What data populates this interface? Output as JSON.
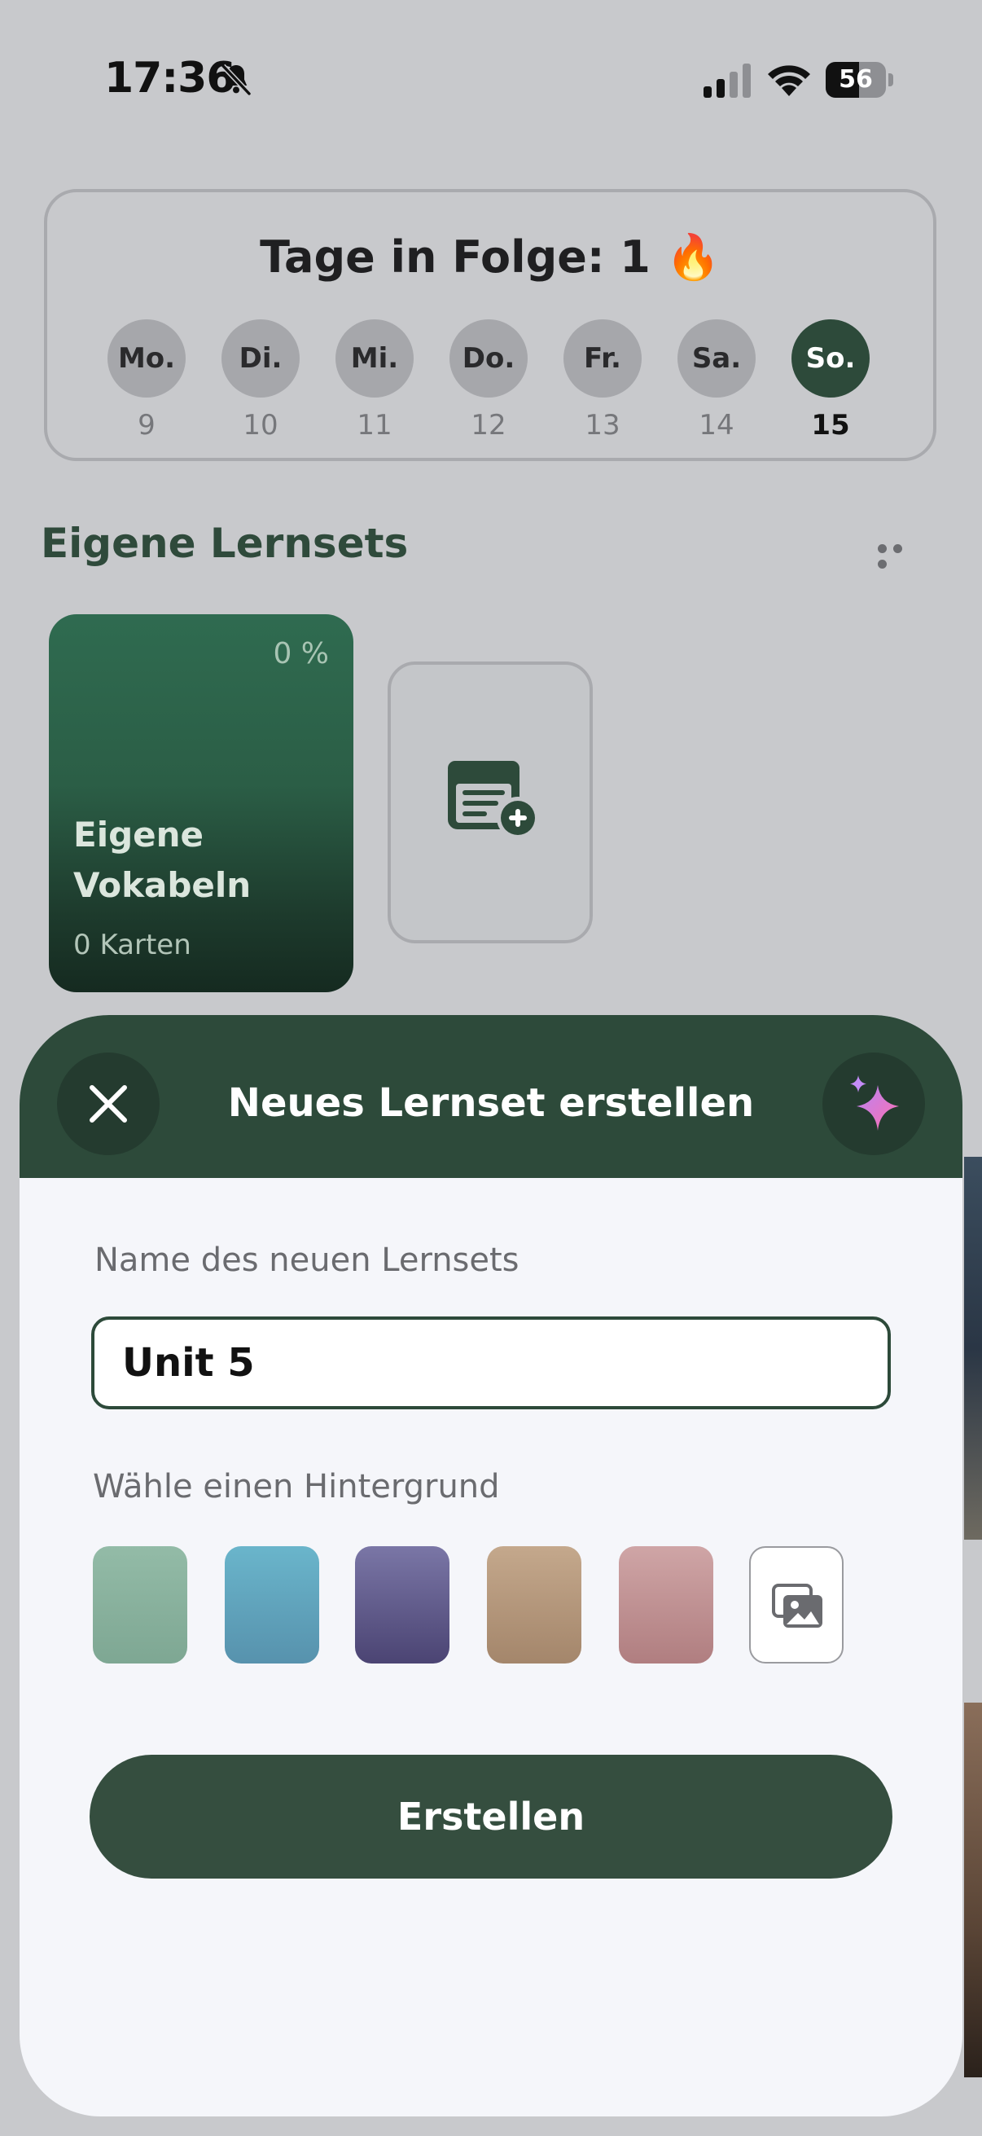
{
  "status_bar": {
    "time": "17:36",
    "battery": "56",
    "battery_level": 0.56,
    "icons": [
      "bell-slash-icon",
      "signal-icon",
      "wifi-icon",
      "battery-icon"
    ]
  },
  "streak": {
    "title": "Tage in Folge: 1 🔥",
    "days": [
      {
        "label": "Mo.",
        "num": "9"
      },
      {
        "label": "Di.",
        "num": "10"
      },
      {
        "label": "Mi.",
        "num": "11"
      },
      {
        "label": "Do.",
        "num": "12"
      },
      {
        "label": "Fr.",
        "num": "13"
      },
      {
        "label": "Sa.",
        "num": "14"
      },
      {
        "label": "So.",
        "num": "15",
        "active": true
      }
    ]
  },
  "section": {
    "title": "Eigene Lernsets"
  },
  "set_card": {
    "percent": "0 %",
    "name": "Eigene Vokabeln",
    "count": "0 Karten"
  },
  "sheet": {
    "title": "Neues Lernset erstellen",
    "name_label": "Name des neuen Lernsets",
    "name_value": "Unit 5",
    "bg_label": "Wähle einen Hintergrund",
    "swatches": [
      {
        "from": "#93bba7",
        "to": "#7ea793"
      },
      {
        "from": "#6ab5cb",
        "to": "#5792ad"
      },
      {
        "from": "#7a76a6",
        "to": "#4b4473"
      },
      {
        "from": "#c4a88c",
        "to": "#a4866b"
      },
      {
        "from": "#cfa5a6",
        "to": "#b07e80"
      }
    ],
    "create_label": "Erstellen"
  },
  "colors": {
    "primary": "#2d4a3a",
    "accent": "#e879c4"
  }
}
